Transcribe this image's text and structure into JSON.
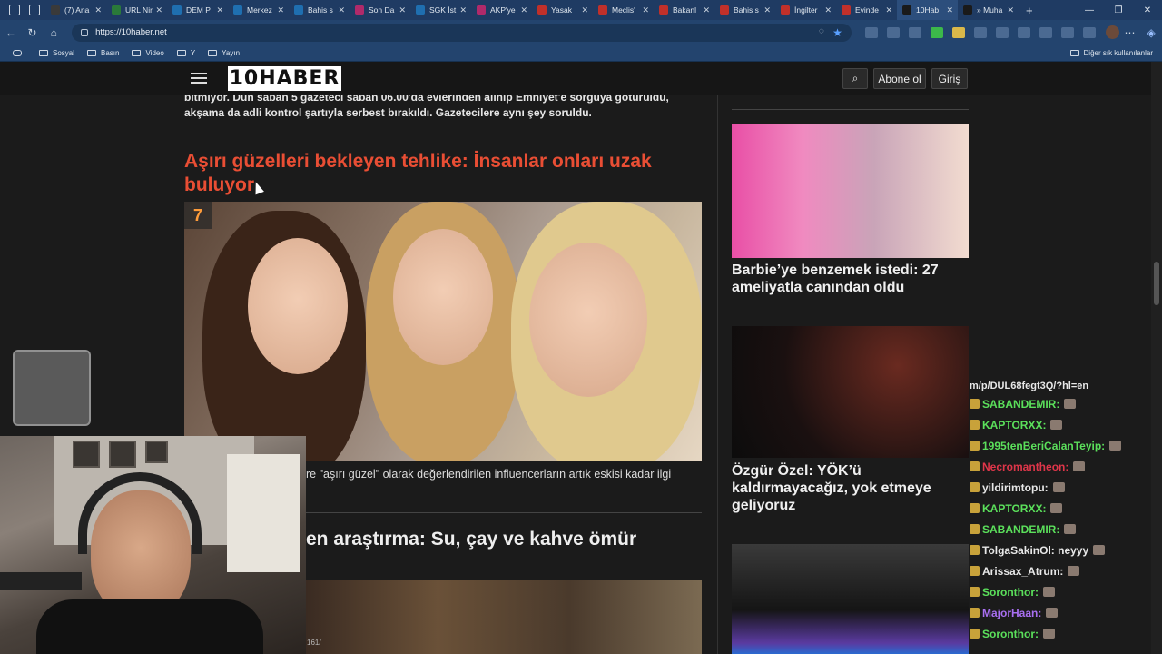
{
  "browser": {
    "tabs": [
      {
        "label": "(7) Ana",
        "color": "#3a3a3a"
      },
      {
        "label": "URL Nir",
        "color": "#2a7a3a"
      },
      {
        "label": "DEM P",
        "color": "#1f6fb0"
      },
      {
        "label": "Merkez",
        "color": "#1f6fb0"
      },
      {
        "label": "Bahis s",
        "color": "#1f6fb0"
      },
      {
        "label": "Son Da",
        "color": "#b02a6a"
      },
      {
        "label": "SGK İst",
        "color": "#1f6fb0"
      },
      {
        "label": "AKP'ye",
        "color": "#b02a6a"
      },
      {
        "label": "Yasak",
        "color": "#c0302a"
      },
      {
        "label": "Meclis'",
        "color": "#c0302a"
      },
      {
        "label": "Bakanl",
        "color": "#c0302a"
      },
      {
        "label": "Bahis s",
        "color": "#c0302a"
      },
      {
        "label": "İngilter",
        "color": "#c0302a"
      },
      {
        "label": "Evinde",
        "color": "#c0302a"
      },
      {
        "label": "10Hab",
        "color": "#1a1a1a",
        "active": true
      },
      {
        "label": "» Muha",
        "color": "#1a1a1a"
      }
    ],
    "url": "https://10haber.net",
    "bookmarks": [
      "Sosyal",
      "Basın",
      "Video",
      "Y",
      "Yayın"
    ],
    "bookmarks_right": "Diğer sık kullanılanlar"
  },
  "site": {
    "logo": "10HABER",
    "abone": "Abone ol",
    "giris": "Giriş"
  },
  "main": {
    "prev_text": "bitmiyor. Dün sabah 5 gazeteci sabah 06.00'da evlerinden alınıp Emniyet'e sorguya götürüldü, akşama da adli kontrol şartıyla serbest bırakıldı. Gazetecilere aynı şey soruldu.",
    "article_title": "Aşırı güzelleri bekleyen tehlike: İnsanlar onları uzak buluyor",
    "article_badge": "7",
    "article_summary": "re \"aşırı güzel\" olarak değerlendirilen influencerların artık eskisi kadar ilgi",
    "article2_title": "en araştırma: Su, çay ve kahve ömür",
    "counter": "161/"
  },
  "sidebar": {
    "item1_title": "Barbie’ye benzemek istedi: 27 ameliyatla canından oldu",
    "item2_title": "Özgür Özel: YÖK’ü kaldırmayacağız, yok etmeye geliyoruz"
  },
  "chat": [
    {
      "user": "m/p/DUL68fegt3Q/?hl=en",
      "color": "#e8e8e8"
    },
    {
      "user": "SABANDEMIR:",
      "color": "#5be05b"
    },
    {
      "user": "KAPTORXX:",
      "color": "#5be05b"
    },
    {
      "user": "1995tenBeriCalanTeyip:",
      "color": "#5be05b"
    },
    {
      "user": "Necromantheon:",
      "color": "#e0364a"
    },
    {
      "user": "yildirimtopu:",
      "color": "#e8e8e8"
    },
    {
      "user": "KAPTORXX:",
      "color": "#5be05b"
    },
    {
      "user": "SABANDEMIR:",
      "color": "#5be05b"
    },
    {
      "user": "TolgaSakinOl: neyyy",
      "color": "#e8e8e8"
    },
    {
      "user": "Arissax_Atrum:",
      "color": "#e8e8e8"
    },
    {
      "user": "Soronthor:",
      "color": "#5be05b"
    },
    {
      "user": "MajorHaan:",
      "color": "#a86ff0"
    },
    {
      "user": "Soronthor:",
      "color": "#5be05b"
    }
  ]
}
